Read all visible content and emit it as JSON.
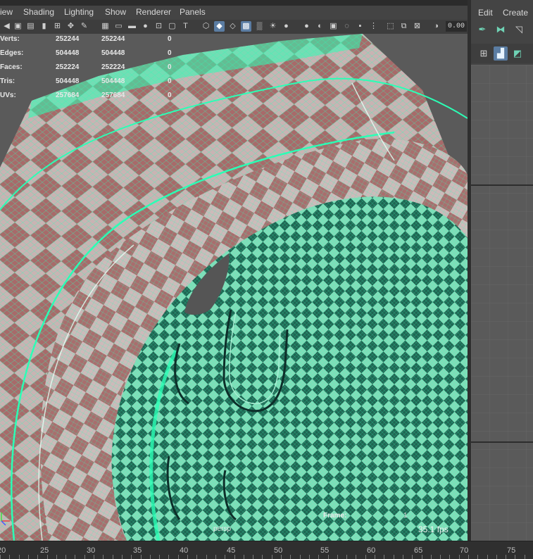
{
  "menubar": {
    "items": [
      "iew",
      "Shading",
      "Lighting",
      "Show",
      "Renderer",
      "Panels"
    ]
  },
  "toolbar": {
    "icons": [
      "select-camera-icon",
      "camera-attributes-icon",
      "bookmark-icon",
      "image-plane-icon",
      "pan-zoom-icon",
      "grease-pencil-icon",
      "grid-icon",
      "film-gate-icon",
      "resolution-gate-icon",
      "gate-mask-icon",
      "field-chart-icon",
      "safe-action-icon",
      "safe-title-icon",
      "wireframe-icon",
      "smooth-shade-icon",
      "wireframe-on-shaded-icon",
      "textured-icon",
      "use-all-lights-icon",
      "shadows-icon",
      "screen-space-ao-icon",
      "motion-blur-icon",
      "multisample-aa-icon",
      "depth-of-field-icon",
      "isolate-select-icon",
      "xray-icon",
      "xray-joints-icon",
      "backface-cull-icon",
      "exposure-icon"
    ],
    "exposure_value": "0.00"
  },
  "hud": {
    "rows": [
      {
        "label": "Verts:",
        "v1": "252244",
        "v2": "252244",
        "v3": "0"
      },
      {
        "label": "Edges:",
        "v1": "504448",
        "v2": "504448",
        "v3": "0"
      },
      {
        "label": "Faces:",
        "v1": "252224",
        "v2": "252224",
        "v3": "0"
      },
      {
        "label": "Tris:",
        "v1": "504448",
        "v2": "504448",
        "v3": "0"
      },
      {
        "label": "UVs:",
        "v1": "257684",
        "v2": "257684",
        "v3": "0"
      }
    ],
    "camera": "persp",
    "frame_label": "Frame:",
    "frame_value": "1",
    "fps": "35.1 fps"
  },
  "right_panel": {
    "menu": [
      "Edit",
      "Create"
    ],
    "tools_row1": [
      "move-tool-icon",
      "snap-together-icon",
      "uv-editor-icon"
    ],
    "tools_row2": [
      "uv-shell-icon",
      "checker-map-icon",
      "distortion-icon"
    ]
  },
  "timeline": {
    "labels": [
      "20",
      "25",
      "30",
      "35",
      "40",
      "45",
      "50",
      "55",
      "60",
      "65",
      "70",
      "75"
    ]
  },
  "colors": {
    "wire": "#1dffb0",
    "check_light": "#c9b3b3",
    "check_dark": "#a86a6a",
    "inner_light": "#7fd8b4",
    "inner_dark": "#1d5f4c",
    "viewport_bg": "#5a5a5a",
    "ui_bg": "#444444"
  }
}
